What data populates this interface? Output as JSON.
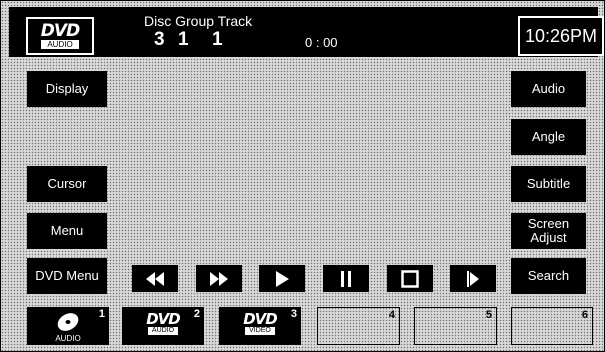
{
  "header": {
    "disc_logo": {
      "brand": "DVD",
      "sub": "AUDIO"
    },
    "labels": "Disc Group Track",
    "disc": "3",
    "group": "1",
    "track": "1",
    "time_code": "0 : 00",
    "clock": "10:26PM"
  },
  "left_buttons": {
    "display": "Display",
    "cursor": "Cursor",
    "menu": "Menu",
    "dvd_menu": "DVD Menu"
  },
  "right_buttons": {
    "audio": "Audio",
    "angle": "Angle",
    "subtitle": "Subtitle",
    "screen_adjust_1": "Screen",
    "screen_adjust_2": "Adjust",
    "search": "Search"
  },
  "transport": {
    "icons": [
      "rewind-icon",
      "fast-forward-icon",
      "play-icon",
      "pause-icon",
      "stop-icon",
      "slow-play-icon"
    ]
  },
  "sources": [
    {
      "number": "1",
      "icon": "cd-icon",
      "sub": "AUDIO"
    },
    {
      "number": "2",
      "brand": "DVD",
      "sub": "AUDIO"
    },
    {
      "number": "3",
      "brand": "DVD",
      "sub": "VIDEO"
    },
    {
      "number": "4"
    },
    {
      "number": "5"
    },
    {
      "number": "6"
    }
  ],
  "colors": {
    "panel": "#000000",
    "background": "#d9d9d9",
    "text": "#ffffff"
  }
}
